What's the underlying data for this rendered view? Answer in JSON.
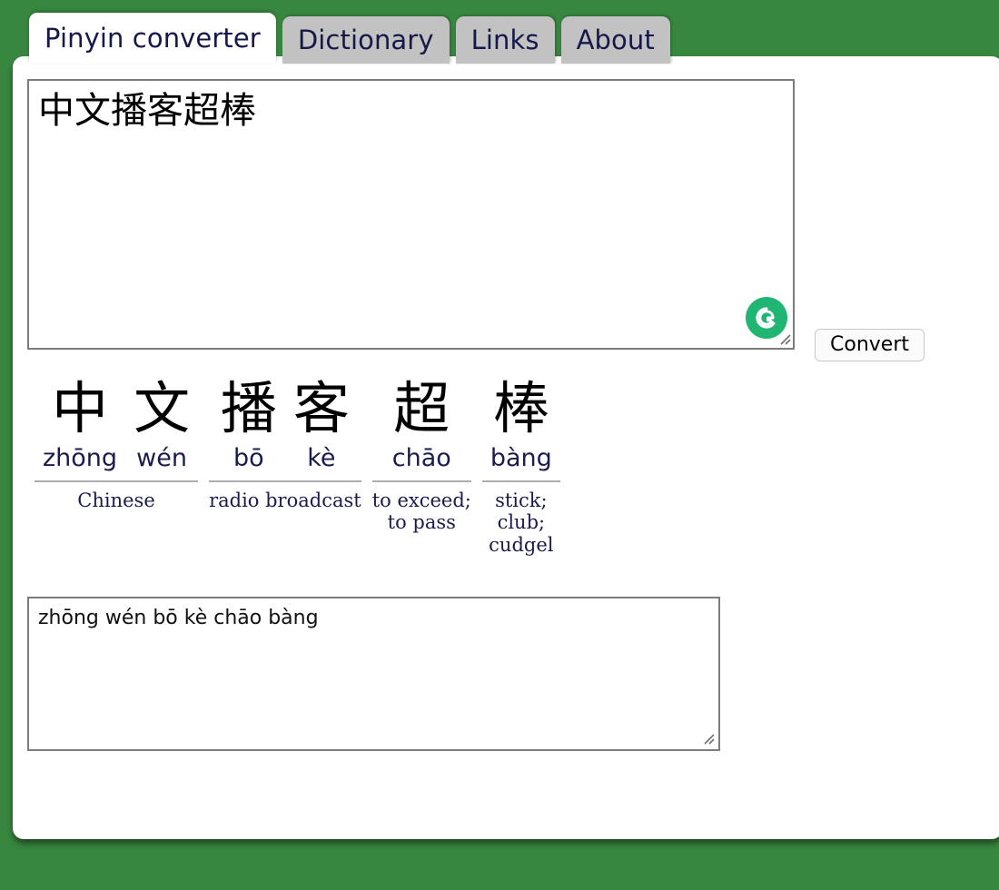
{
  "theme": {
    "background_green": "#38873f",
    "tab_active_bg": "#ffffff",
    "tab_inactive_bg": "#c2c2c2",
    "tab_text": "#16184a",
    "pinyin_color": "#1b1c4e",
    "grammarly_green": "#21b573"
  },
  "tabs": [
    {
      "label": "Pinyin converter",
      "active": true
    },
    {
      "label": "Dictionary",
      "active": false
    },
    {
      "label": "Links",
      "active": false
    },
    {
      "label": "About",
      "active": false
    }
  ],
  "input": {
    "value": "中文播客超棒",
    "placeholder": ""
  },
  "grammarly": {
    "icon": "grammarly-g-icon",
    "letter": "G"
  },
  "convert_button": {
    "label": "Convert"
  },
  "results": [
    {
      "characters": [
        {
          "hanzi": "中",
          "pinyin": "zhōng"
        },
        {
          "hanzi": "文",
          "pinyin": "wén"
        }
      ],
      "definition": "Chinese"
    },
    {
      "characters": [
        {
          "hanzi": "播",
          "pinyin": "bō"
        },
        {
          "hanzi": "客",
          "pinyin": "kè"
        }
      ],
      "definition": "radio broadcast"
    },
    {
      "characters": [
        {
          "hanzi": "超",
          "pinyin": "chāo"
        }
      ],
      "definition": "to exceed;\nto pass"
    },
    {
      "characters": [
        {
          "hanzi": "棒",
          "pinyin": "bàng"
        }
      ],
      "definition": "stick;\nclub;\ncudgel"
    }
  ],
  "output": {
    "value": "zhōng wén bō kè chāo bàng",
    "placeholder": ""
  }
}
